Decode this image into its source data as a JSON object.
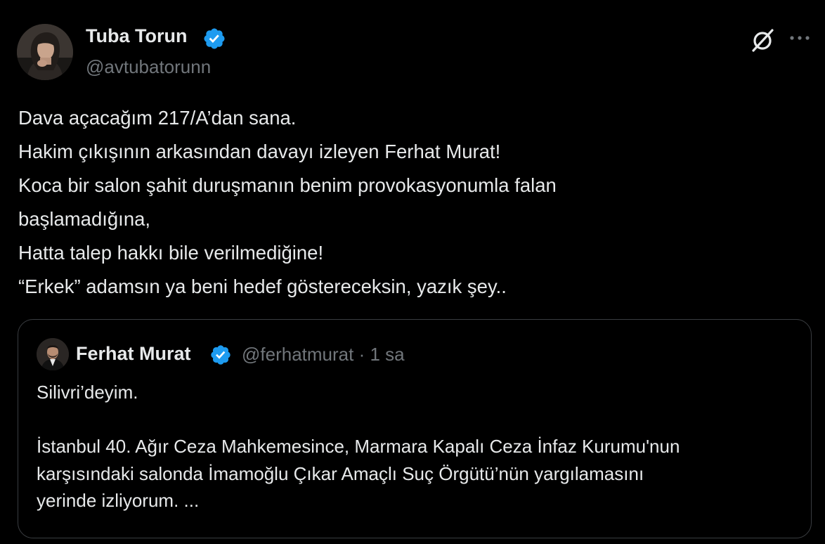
{
  "author": {
    "name": "Tuba Torun",
    "handle": "@avtubatorunn",
    "verified_icon": "verified-badge-icon",
    "verified_color": "#1d9bf0"
  },
  "actions": {
    "grok_icon": "grok-icon",
    "more_icon": "more-options-icon"
  },
  "tweet": {
    "lines": [
      "Dava açacağım 217/A’dan sana.",
      "Hakim çıkışının arkasından davayı izleyen Ferhat Murat!",
      "Koca bir salon şahit duruşmanın benim provokasyonumla falan",
      "başlamadığına,",
      "Hatta talep hakkı bile verilmediğine!",
      "“Erkek” adamsın ya beni hedef göstereceksin, yazık şey.."
    ]
  },
  "quote": {
    "author": {
      "name": "Ferhat Murat",
      "handle": "@ferhatmurat",
      "separator": "·",
      "time": "1 sa"
    },
    "lines": [
      "Silivri’deyim.",
      "",
      "İstanbul 40. Ağır Ceza Mahkemesince, Marmara Kapalı Ceza İnfaz Kurumu'nun",
      "karşısındaki salonda İmamoğlu Çıkar Amaçlı Suç Örgütü’nün yargılamasını",
      "yerinde izliyorum. ..."
    ]
  },
  "colors": {
    "background": "#000000",
    "text_primary": "#e7e9ea",
    "text_secondary": "#71767b",
    "border": "#3a3d41",
    "accent": "#1d9bf0"
  }
}
